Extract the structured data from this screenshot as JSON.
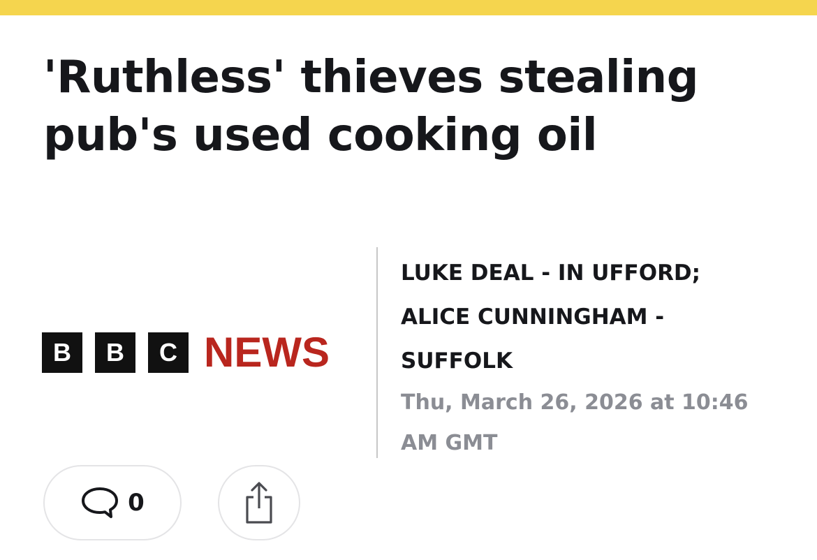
{
  "colors": {
    "top_bar": "#f5d54e",
    "headline": "#16171b",
    "news_red": "#b9261e",
    "timestamp": "#8b8d94"
  },
  "article": {
    "headline": "'Ruthless' thieves stealing pub's used cooking oil",
    "source_logo": {
      "letters": [
        "B",
        "B",
        "C"
      ],
      "word": "NEWS"
    },
    "byline": {
      "lines": [
        "LUKE DEAL - IN UFFORD;",
        "ALICE CUNNINGHAM -",
        "SUFFOLK"
      ]
    },
    "timestamp": "Thu, March 26, 2026 at 10:46 AM GMT"
  },
  "actions": {
    "comments": {
      "icon": "comment-bubble-icon",
      "count": "0"
    },
    "share": {
      "icon": "share-icon"
    }
  }
}
